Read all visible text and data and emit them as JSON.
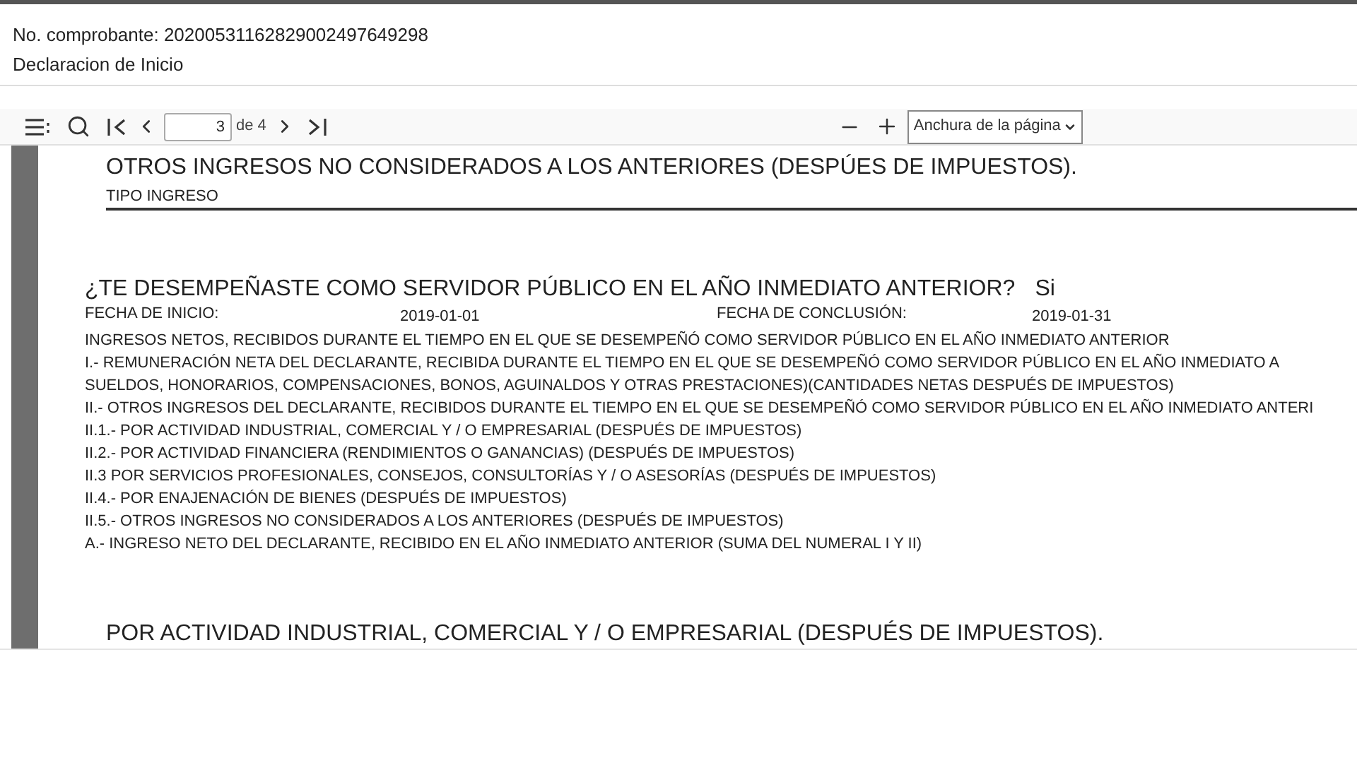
{
  "header": {
    "receipt": "No. comprobante: 20200531162829002497649298",
    "declaration_type": "Declaracion de Inicio"
  },
  "toolbar": {
    "page_input": "3",
    "page_total": "de 4",
    "zoom_select": "Anchura de la página"
  },
  "document": {
    "section_title": "OTROS INGRESOS NO CONSIDERADOS A LOS ANTERIORES (DESPÚES DE IMPUESTOS).",
    "column_header": "TIPO INGRESO",
    "question": "¿TE DESEMPEÑASTE COMO SERVIDOR PÚBLICO EN EL AÑO INMEDIATO ANTERIOR?",
    "answer": "Si",
    "dates": [
      {
        "label": "FECHA DE INICIO:",
        "value": "2019-01-01"
      },
      {
        "label": "FECHA DE CONCLUSIÓN:",
        "value": "2019-01-31"
      }
    ],
    "lines": [
      "INGRESOS NETOS, RECIBIDOS DURANTE EL TIEMPO EN EL QUE SE DESEMPEÑÓ COMO SERVIDOR PÚBLICO EN EL AÑO INMEDIATO ANTERIOR",
      "I.- REMUNERACIÓN NETA DEL DECLARANTE, RECIBIDA DURANTE EL TIEMPO EN EL QUE SE DESEMPEÑÓ COMO SERVIDOR PÚBLICO EN EL AÑO INMEDIATO A",
      "SUELDOS, HONORARIOS, COMPENSACIONES, BONOS, AGUINALDOS Y OTRAS PRESTACIONES)(CANTIDADES NETAS DESPUÉS DE IMPUESTOS)",
      "II.- OTROS INGRESOS DEL DECLARANTE, RECIBIDOS DURANTE EL TIEMPO EN EL QUE SE DESEMPEÑÓ COMO SERVIDOR PÚBLICO EN EL AÑO INMEDIATO ANTERI",
      "II.1.- POR ACTIVIDAD INDUSTRIAL, COMERCIAL Y / O EMPRESARIAL (DESPUÉS DE IMPUESTOS)",
      "II.2.- POR ACTIVIDAD FINANCIERA (RENDIMIENTOS O GANANCIAS) (DESPUÉS DE IMPUESTOS)",
      "II.3 POR SERVICIOS PROFESIONALES, CONSEJOS, CONSULTORÍAS Y / O ASESORÍAS (DESPUÉS DE IMPUESTOS)",
      "II.4.- POR ENAJENACIÓN DE BIENES (DESPUÉS DE IMPUESTOS)",
      "II.5.- OTROS INGRESOS NO CONSIDERADOS A LOS ANTERIORES (DESPUÉS DE IMPUESTOS)",
      "A.- INGRESO NETO DEL DECLARANTE, RECIBIDO EN EL AÑO INMEDIATO ANTERIOR (SUMA DEL NUMERAL I Y II)"
    ],
    "next_section_title": "POR ACTIVIDAD INDUSTRIAL, COMERCIAL Y / O EMPRESARIAL (DESPUÉS DE IMPUESTOS)."
  }
}
